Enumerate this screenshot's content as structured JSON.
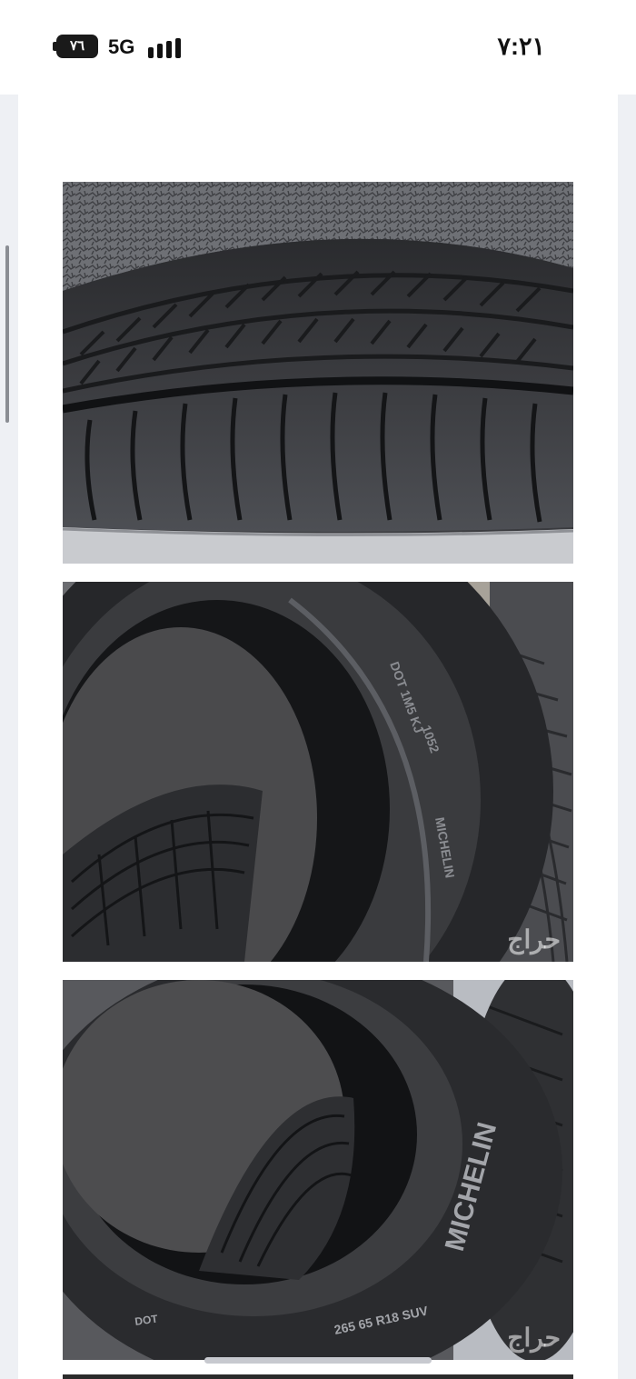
{
  "status_bar": {
    "battery": "٧٦",
    "network": "5G",
    "time": "٧:٢١"
  },
  "gallery": {
    "photos": [
      {
        "subject": "tire tread close-up",
        "watermark": ""
      },
      {
        "subject": "tire sidewall interior",
        "watermark": "حراج"
      },
      {
        "subject": "tire sidewall with brand markings",
        "watermark": "حراج"
      }
    ]
  },
  "colors": {
    "rubber": "#2e2f33",
    "rubber_dark": "#1b1c1f",
    "rubber_light": "#5a5c61",
    "carpet": "#4a4a4c",
    "background": "#eef0f4"
  }
}
